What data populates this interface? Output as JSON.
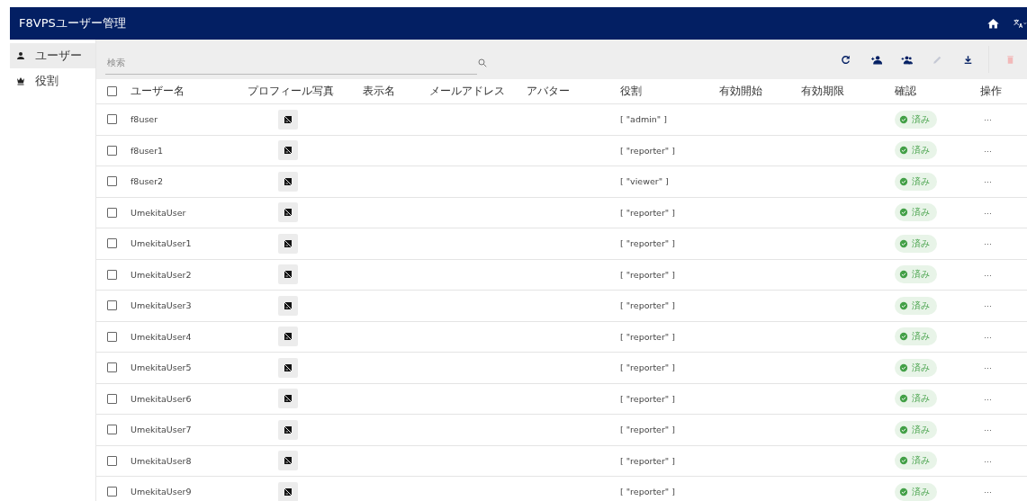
{
  "app_bar": {
    "title": "F8VPSユーザー管理"
  },
  "sidebar": {
    "items": [
      {
        "label": "ユーザー",
        "kind": "person",
        "selected": true
      },
      {
        "label": "役割",
        "kind": "crown",
        "selected": false
      }
    ]
  },
  "toolbar": {
    "search": {
      "placeholder": "検索"
    },
    "actions": [
      {
        "kind": "refresh",
        "disabled": false
      },
      {
        "kind": "add-person",
        "disabled": false
      },
      {
        "kind": "add-group",
        "disabled": false
      },
      {
        "kind": "edit",
        "disabled": true
      },
      {
        "kind": "download",
        "disabled": false
      },
      {
        "kind": "delete",
        "disabled": true
      }
    ]
  },
  "table": {
    "columns": [
      "ユーザー名",
      "プロフィール写真",
      "表示名",
      "メールアドレス",
      "アバター",
      "役割",
      "有効開始",
      "有効期限",
      "確認",
      "操作"
    ],
    "select_all": {
      "checked": false
    },
    "rows": [
      {
        "username": "f8user",
        "role": "[ \"admin\" ]",
        "verified": "済み",
        "checked": false,
        "menu": "···"
      },
      {
        "username": "f8user1",
        "role": "[ \"reporter\" ]",
        "verified": "済み",
        "checked": false,
        "menu": "···"
      },
      {
        "username": "f8user2",
        "role": "[ \"viewer\" ]",
        "verified": "済み",
        "checked": false,
        "menu": "···"
      },
      {
        "username": "UmekitaUser",
        "role": "[ \"reporter\" ]",
        "verified": "済み",
        "checked": false,
        "menu": "···"
      },
      {
        "username": "UmekitaUser1",
        "role": "[ \"reporter\" ]",
        "verified": "済み",
        "checked": false,
        "menu": "···"
      },
      {
        "username": "UmekitaUser2",
        "role": "[ \"reporter\" ]",
        "verified": "済み",
        "checked": false,
        "menu": "···"
      },
      {
        "username": "UmekitaUser3",
        "role": "[ \"reporter\" ]",
        "verified": "済み",
        "checked": false,
        "menu": "···"
      },
      {
        "username": "UmekitaUser4",
        "role": "[ \"reporter\" ]",
        "verified": "済み",
        "checked": false,
        "menu": "···"
      },
      {
        "username": "UmekitaUser5",
        "role": "[ \"reporter\" ]",
        "verified": "済み",
        "checked": false,
        "menu": "···"
      },
      {
        "username": "UmekitaUser6",
        "role": "[ \"reporter\" ]",
        "verified": "済み",
        "checked": false,
        "menu": "···"
      },
      {
        "username": "UmekitaUser7",
        "role": "[ \"reporter\" ]",
        "verified": "済み",
        "checked": false,
        "menu": "···"
      },
      {
        "username": "UmekitaUser8",
        "role": "[ \"reporter\" ]",
        "verified": "済み",
        "checked": false,
        "menu": "···"
      },
      {
        "username": "UmekitaUser9",
        "role": "[ \"reporter\" ]",
        "verified": "済み",
        "checked": false,
        "menu": "···"
      }
    ]
  }
}
